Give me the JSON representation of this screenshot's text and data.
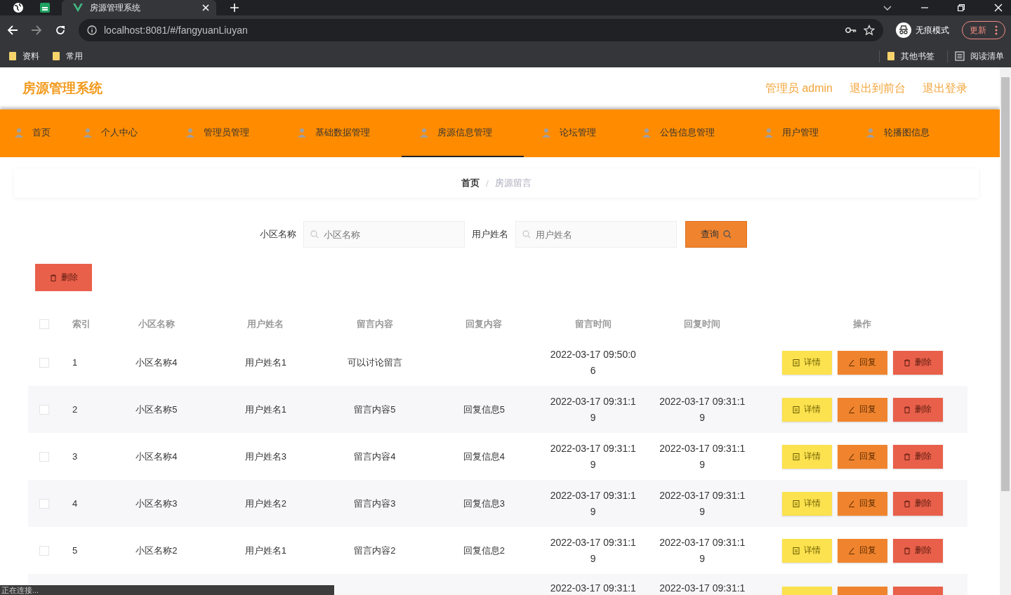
{
  "browser": {
    "tab_title": "房源管理系统",
    "url": "localhost:8081/#/fangyuanLiuyan",
    "profile_label": "无痕模式",
    "update_label": "更新",
    "bookmarks": [
      "资料",
      "常用"
    ],
    "other_bookmarks": "其他书签",
    "reading_list": "阅读清单"
  },
  "header": {
    "title": "房源管理系统",
    "links": [
      "管理员 admin",
      "退出到前台",
      "退出登录"
    ]
  },
  "nav": [
    {
      "label": "首页",
      "selected": false
    },
    {
      "label": "个人中心",
      "selected": false
    },
    {
      "label": "管理员管理",
      "selected": false
    },
    {
      "label": "基础数据管理",
      "selected": false
    },
    {
      "label": "房源信息管理",
      "selected": true
    },
    {
      "label": "论坛管理",
      "selected": false
    },
    {
      "label": "公告信息管理",
      "selected": false
    },
    {
      "label": "用户管理",
      "selected": false
    },
    {
      "label": "轮播图信息",
      "selected": false
    }
  ],
  "breadcrumb": {
    "separator": "/",
    "items": [
      "首页",
      "房源留言"
    ]
  },
  "search": {
    "fields": [
      {
        "label": "小区名称",
        "placeholder": "小区名称"
      },
      {
        "label": "用户姓名",
        "placeholder": "用户姓名"
      }
    ],
    "button": "查询"
  },
  "bulk_delete": "删除",
  "table": {
    "select_all_checked": false,
    "columns": [
      "索引",
      "小区名称",
      "用户姓名",
      "留言内容",
      "回复内容",
      "留言时间",
      "回复时间",
      "操作"
    ],
    "rows": [
      {
        "kind": "full",
        "checked": false,
        "cells": [
          "1",
          "小区名称4",
          "用户姓名1",
          "可以讨论留言",
          "",
          "2022-03-17 09:50:06",
          ""
        ],
        "actions": [
          "详情",
          "回复",
          "删除"
        ]
      },
      {
        "kind": "full",
        "checked": false,
        "cells": [
          "2",
          "小区名称5",
          "用户姓名1",
          "留言内容5",
          "回复信息5",
          "2022-03-17 09:31:19",
          "2022-03-17 09:31:19"
        ],
        "actions": [
          "详情",
          "回复",
          "删除"
        ]
      },
      {
        "kind": "full",
        "checked": false,
        "cells": [
          "3",
          "小区名称4",
          "用户姓名3",
          "留言内容4",
          "回复信息4",
          "2022-03-17 09:31:19",
          "2022-03-17 09:31:19"
        ],
        "actions": [
          "详情",
          "回复",
          "删除"
        ]
      },
      {
        "kind": "full",
        "checked": false,
        "cells": [
          "4",
          "小区名称3",
          "用户姓名2",
          "留言内容3",
          "回复信息3",
          "2022-03-17 09:31:19",
          "2022-03-17 09:31:19"
        ],
        "actions": [
          "详情",
          "回复",
          "删除"
        ]
      },
      {
        "kind": "full",
        "checked": false,
        "cells": [
          "5",
          "小区名称2",
          "用户姓名1",
          "留言内容2",
          "回复信息2",
          "2022-03-17 09:31:19",
          "2022-03-17 09:31:19"
        ],
        "actions": [
          "详情",
          "回复",
          "删除"
        ]
      },
      {
        "kind": "partial",
        "cells": [
          "",
          "",
          "",
          "",
          "",
          "2022-03-17 09:31:1",
          "2022-03-17 09:31:1"
        ]
      }
    ]
  },
  "status_text": "正在连接..."
}
